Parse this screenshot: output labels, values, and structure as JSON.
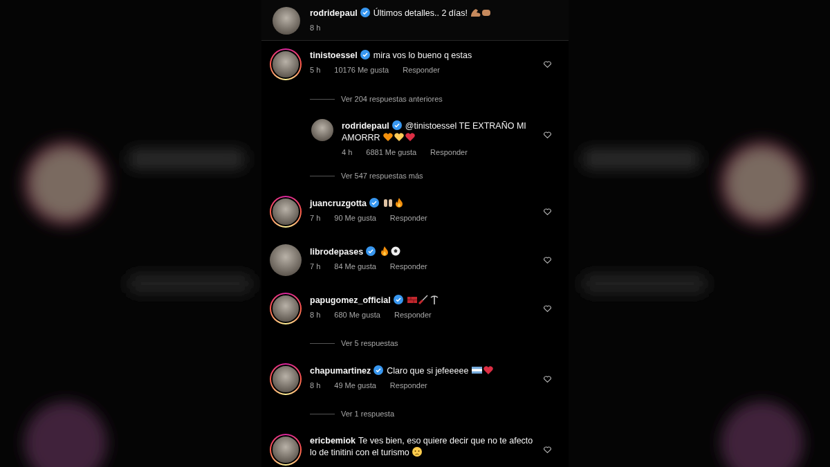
{
  "post": {
    "username": "rodridepaul",
    "verified": true,
    "caption": "Últimos detalles.. 2 días!",
    "emojis": [
      {
        "kind": "arm"
      },
      {
        "kind": "fist"
      }
    ],
    "time": "8 h"
  },
  "comments": [
    {
      "kind": "comment",
      "username": "tinistoessel",
      "verified": true,
      "story_ring": true,
      "text": "mira vos lo bueno q estas",
      "time": "5 h",
      "likes": "10176 Me gusta",
      "reply_label": "Responder",
      "liked": false
    },
    {
      "kind": "view_replies",
      "label": "Ver 204 respuestas anteriores"
    },
    {
      "kind": "reply",
      "username": "rodridepaul",
      "verified": true,
      "story_ring": false,
      "text": "@tinistoessel TE EXTRAÑO MI AMORRR",
      "emojis": [
        {
          "kind": "heart",
          "color": "#f4900c"
        },
        {
          "kind": "heart",
          "color": "#fdcb58"
        },
        {
          "kind": "heart",
          "color": "#dd2e44"
        }
      ],
      "time": "4 h",
      "likes": "6881 Me gusta",
      "reply_label": "Responder",
      "liked": false
    },
    {
      "kind": "view_replies",
      "label": "Ver 547 respuestas más"
    },
    {
      "kind": "comment",
      "username": "juancruzgotta",
      "verified": true,
      "story_ring": true,
      "emojis": [
        {
          "kind": "hands"
        },
        {
          "kind": "fire"
        }
      ],
      "time": "7 h",
      "likes": "90 Me gusta",
      "reply_label": "Responder",
      "liked": false
    },
    {
      "kind": "comment",
      "username": "librodepases",
      "verified": true,
      "story_ring": false,
      "emojis": [
        {
          "kind": "fire"
        },
        {
          "kind": "ball"
        }
      ],
      "time": "7 h",
      "likes": "84 Me gusta",
      "reply_label": "Responder",
      "liked": false
    },
    {
      "kind": "comment",
      "username": "papugomez_official",
      "verified": true,
      "story_ring": true,
      "emojis": [
        {
          "kind": "brick"
        },
        {
          "kind": "screwdriver"
        },
        {
          "kind": "pickaxe"
        }
      ],
      "time": "8 h",
      "likes": "680 Me gusta",
      "reply_label": "Responder",
      "liked": false
    },
    {
      "kind": "view_replies",
      "label": "Ver 5 respuestas"
    },
    {
      "kind": "comment",
      "username": "chapumartinez",
      "verified": true,
      "story_ring": true,
      "text": "Claro que si jefeeeee",
      "emojis": [
        {
          "kind": "flag"
        },
        {
          "kind": "heart",
          "color": "#dd2e44"
        }
      ],
      "time": "8 h",
      "likes": "49 Me gusta",
      "reply_label": "Responder",
      "liked": false
    },
    {
      "kind": "view_replies",
      "label": "Ver 1 respuesta"
    },
    {
      "kind": "comment",
      "username": "ericbemiok",
      "verified": false,
      "story_ring": true,
      "text": "Te ves bien, eso quiere decir que no te afecto lo de tinitini con el turismo",
      "emojis": [
        {
          "kind": "face"
        }
      ],
      "liked": false
    }
  ]
}
